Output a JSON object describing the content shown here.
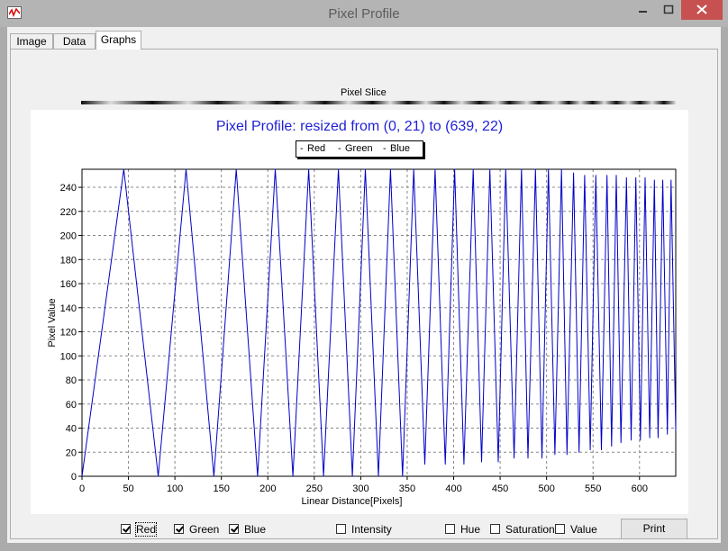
{
  "window": {
    "title": "Pixel Profile",
    "accent_close": "#c75050"
  },
  "tabs": [
    {
      "label": "Image",
      "active": false
    },
    {
      "label": "Data",
      "active": false
    },
    {
      "label": "Graphs",
      "active": true
    }
  ],
  "slice": {
    "label": "Pixel Slice"
  },
  "chart_data": {
    "type": "line",
    "title": "Pixel Profile:   resized   from (0, 21) to (639, 22)",
    "xlabel": "Linear Distance[Pixels]",
    "ylabel": "Pixel Value",
    "xlim": [
      0,
      639
    ],
    "ylim": [
      0,
      255
    ],
    "xticks": [
      0,
      50,
      100,
      150,
      200,
      250,
      300,
      350,
      400,
      450,
      500,
      550,
      600
    ],
    "yticks": [
      0,
      20,
      40,
      60,
      80,
      100,
      120,
      140,
      160,
      180,
      200,
      220,
      240
    ],
    "grid": true,
    "legend": {
      "placement": "top-center",
      "entries": [
        "Red",
        "Green",
        "Blue"
      ]
    },
    "series": [
      {
        "name": "Blue",
        "color": "#0000c8",
        "points": [
          [
            0,
            0
          ],
          [
            45,
            255
          ],
          [
            82,
            0
          ],
          [
            112,
            255
          ],
          [
            142,
            0
          ],
          [
            166,
            255
          ],
          [
            189,
            0
          ],
          [
            208,
            255
          ],
          [
            227,
            0
          ],
          [
            244,
            255
          ],
          [
            260,
            0
          ],
          [
            276,
            255
          ],
          [
            291,
            0
          ],
          [
            305,
            255
          ],
          [
            319,
            0
          ],
          [
            332,
            255
          ],
          [
            345,
            0
          ],
          [
            357,
            255
          ],
          [
            369,
            10
          ],
          [
            380,
            255
          ],
          [
            391,
            10
          ],
          [
            401,
            255
          ],
          [
            411,
            10
          ],
          [
            421,
            255
          ],
          [
            430,
            12
          ],
          [
            439,
            255
          ],
          [
            448,
            12
          ],
          [
            456,
            255
          ],
          [
            465,
            15
          ],
          [
            473,
            255
          ],
          [
            480,
            15
          ],
          [
            488,
            255
          ],
          [
            495,
            15
          ],
          [
            502,
            255
          ],
          [
            509,
            18
          ],
          [
            516,
            255
          ],
          [
            522,
            18
          ],
          [
            529,
            252
          ],
          [
            535,
            20
          ],
          [
            541,
            250
          ],
          [
            547,
            22
          ],
          [
            553,
            250
          ],
          [
            559,
            22
          ],
          [
            565,
            250
          ],
          [
            570,
            25
          ],
          [
            575,
            250
          ],
          [
            580,
            28
          ],
          [
            586,
            248
          ],
          [
            591,
            30
          ],
          [
            596,
            248
          ],
          [
            601,
            30
          ],
          [
            606,
            248
          ],
          [
            611,
            32
          ],
          [
            616,
            246
          ],
          [
            620,
            32
          ],
          [
            625,
            246
          ],
          [
            630,
            35
          ],
          [
            634,
            246
          ],
          [
            639,
            38
          ]
        ]
      }
    ]
  },
  "checkboxes": [
    {
      "label": "Red",
      "checked": true
    },
    {
      "label": "Green",
      "checked": true
    },
    {
      "label": "Blue",
      "checked": true
    },
    {
      "label": "Intensity",
      "checked": false
    },
    {
      "label": "Hue",
      "checked": false
    },
    {
      "label": "Saturation",
      "checked": false
    },
    {
      "label": "Value",
      "checked": false
    }
  ],
  "print_label": "Print"
}
